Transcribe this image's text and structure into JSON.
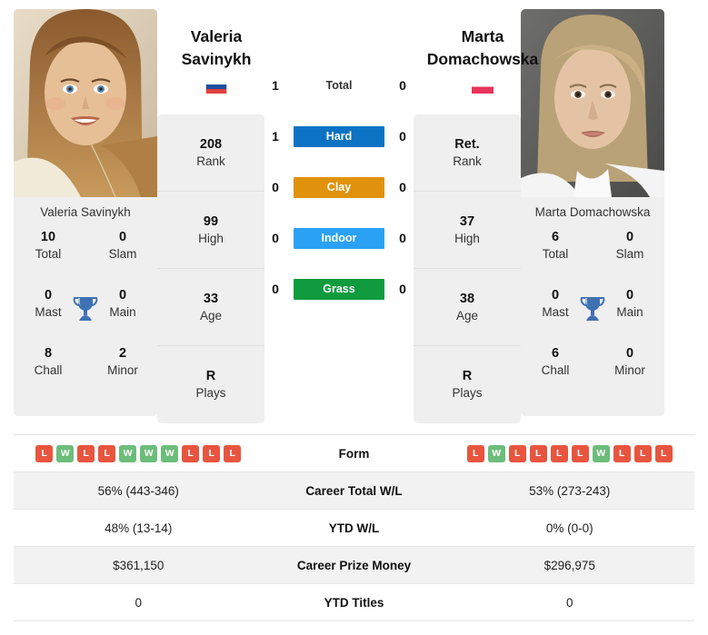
{
  "colors": {
    "hard": "#0b72c4",
    "clay": "#e0920c",
    "indoor": "#2ba1f5",
    "grass": "#0f9b3e",
    "win": "#6cbd7a",
    "loss": "#e8553f",
    "trophy": "#3f72b4",
    "card_bg": "#efefef",
    "row_shade": "#f2f2f2"
  },
  "left_player": {
    "name_line1": "Valeria",
    "name_line2": "Savinykh",
    "full_name": "Valeria Savinykh",
    "flag": "russia-flag",
    "stats": [
      {
        "value": "208",
        "label": "Rank"
      },
      {
        "value": "99",
        "label": "High"
      },
      {
        "value": "33",
        "label": "Age"
      },
      {
        "value": "R",
        "label": "Plays"
      }
    ],
    "titles": [
      {
        "value": "10",
        "label": "Total"
      },
      {
        "value": "0",
        "label": "Slam"
      },
      {
        "value": "0",
        "label": "Mast"
      },
      {
        "value": "0",
        "label": "Main"
      },
      {
        "value": "8",
        "label": "Chall"
      },
      {
        "value": "2",
        "label": "Minor"
      }
    ],
    "form": [
      "L",
      "W",
      "L",
      "L",
      "W",
      "W",
      "W",
      "L",
      "L",
      "L"
    ]
  },
  "right_player": {
    "name_line1": "Marta",
    "name_line2": "Domachowska",
    "full_name": "Marta Domachowska",
    "flag": "poland-flag",
    "stats": [
      {
        "value": "Ret.",
        "label": "Rank"
      },
      {
        "value": "37",
        "label": "High"
      },
      {
        "value": "38",
        "label": "Age"
      },
      {
        "value": "R",
        "label": "Plays"
      }
    ],
    "titles": [
      {
        "value": "6",
        "label": "Total"
      },
      {
        "value": "0",
        "label": "Slam"
      },
      {
        "value": "0",
        "label": "Mast"
      },
      {
        "value": "0",
        "label": "Main"
      },
      {
        "value": "6",
        "label": "Chall"
      },
      {
        "value": "0",
        "label": "Minor"
      }
    ],
    "form": [
      "L",
      "W",
      "L",
      "L",
      "L",
      "L",
      "W",
      "L",
      "L",
      "L"
    ]
  },
  "surfaces": [
    {
      "label": "Total",
      "left": "1",
      "right": "0",
      "style": "plain"
    },
    {
      "label": "Hard",
      "left": "1",
      "right": "0",
      "style": "hard"
    },
    {
      "label": "Clay",
      "left": "0",
      "right": "0",
      "style": "clay"
    },
    {
      "label": "Indoor",
      "left": "0",
      "right": "0",
      "style": "indoor"
    },
    {
      "label": "Grass",
      "left": "0",
      "right": "0",
      "style": "grass"
    }
  ],
  "table": {
    "rows": [
      {
        "label": "Form",
        "left": "",
        "right": "",
        "type": "form",
        "shade": false
      },
      {
        "label": "Career Total W/L",
        "left": "56% (443-346)",
        "right": "53% (273-243)",
        "type": "text",
        "shade": true
      },
      {
        "label": "YTD W/L",
        "left": "48% (13-14)",
        "right": "0% (0-0)",
        "type": "text",
        "shade": false
      },
      {
        "label": "Career Prize Money",
        "left": "$361,150",
        "right": "$296,975",
        "type": "text",
        "shade": true
      },
      {
        "label": "YTD Titles",
        "left": "0",
        "right": "0",
        "type": "text",
        "shade": false
      }
    ]
  }
}
